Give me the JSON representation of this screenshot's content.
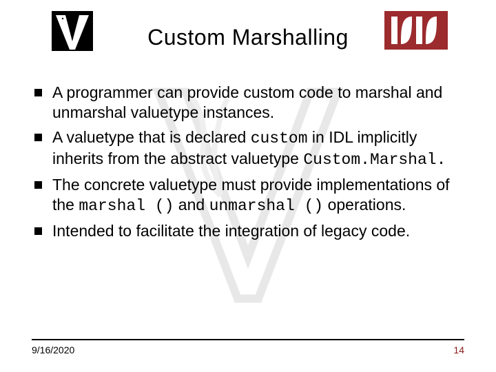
{
  "title": "Custom Marshalling",
  "bullets": [
    {
      "pre": "A programmer can provide custom code to marshal and unmarshal valuetype instances.",
      "code": "",
      "post": ""
    },
    {
      "pre": "A valuetype that is declared ",
      "code": "custom",
      "post": " in IDL implicitly inherits from the abstract valuetype ",
      "code2": "Custom.Marshal.",
      "post2": ""
    },
    {
      "pre": "The concrete valuetype must provide implementations of the ",
      "code": "marshal ()",
      "post": " and ",
      "code2": "unmarshal ()",
      "post2": " operations."
    },
    {
      "pre": "Intended to facilitate the integration of legacy code.",
      "code": "",
      "post": ""
    }
  ],
  "footer": {
    "date": "9/16/2020",
    "page": "14"
  }
}
